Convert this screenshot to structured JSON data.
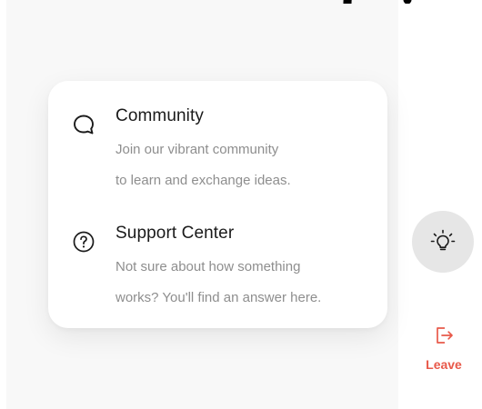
{
  "menu": {
    "items": [
      {
        "title": "Community",
        "description_line1": "Join our vibrant community",
        "description_line2": "to learn and exchange ideas.",
        "icon": "chat-bubble-icon"
      },
      {
        "title": "Support Center",
        "description_line1": "Not sure about how something",
        "description_line2": "works? You'll find an answer here.",
        "icon": "question-circle-icon"
      }
    ]
  },
  "sidebar": {
    "hint_icon": "lightbulb-icon",
    "leave_label": "Leave",
    "leave_icon": "exit-icon",
    "leave_color": "#e8594a"
  }
}
